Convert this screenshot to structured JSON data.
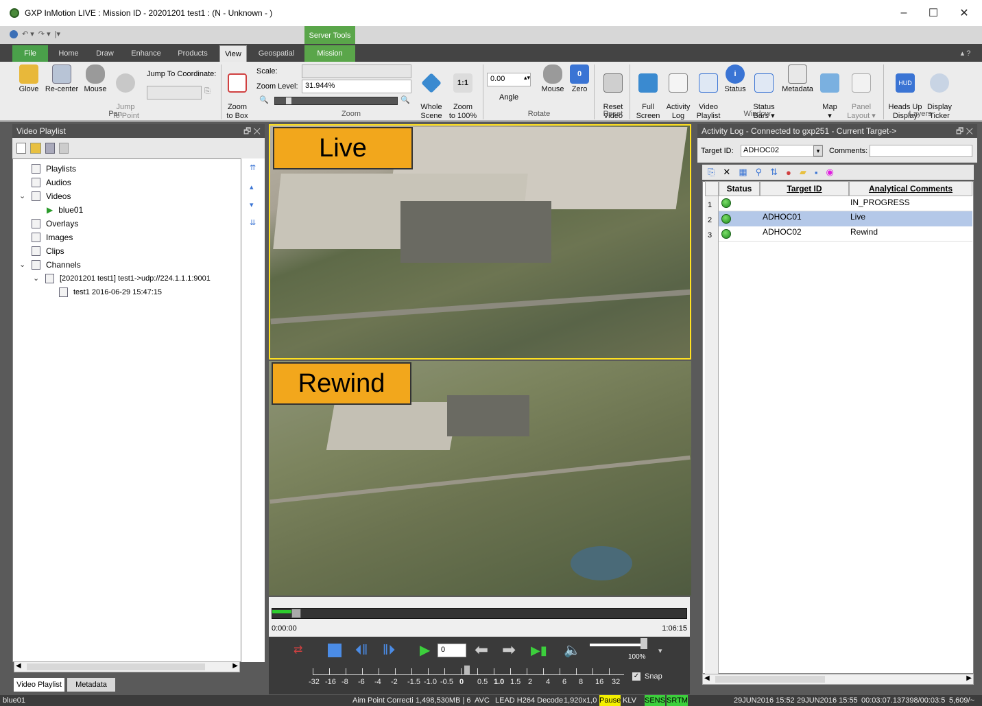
{
  "window": {
    "title": "GXP InMotion LIVE : Mission ID - 20201201 test1 : (N - Unknown - )",
    "controls": [
      "–",
      "☐",
      "✕"
    ]
  },
  "ribbon": {
    "contextual_tab": "Server Tools",
    "tabs": [
      "File",
      "Home",
      "Draw",
      "Enhance",
      "Products",
      "View",
      "Geospatial",
      "Mission"
    ],
    "active_tab": "View",
    "pan": {
      "label": "Pan",
      "glove": "Glove",
      "recenter": "Re-center",
      "mouse": "Mouse",
      "jump": "Jump\nTo Point",
      "jump_coord_label": "Jump To Coordinate:",
      "jump_coord_value": ""
    },
    "zoom": {
      "label": "Zoom",
      "zoom_to_box": "Zoom\nto Box",
      "scale_label": "Scale:",
      "scale_value": "",
      "zoom_level_label": "Zoom Level:",
      "zoom_level_value": "31.944%",
      "whole_scene": "Whole\nScene",
      "zoom_100": "Zoom\nto 100%"
    },
    "rotate": {
      "label": "Rotate",
      "angle_value": "0.00",
      "angle": "Angle",
      "mouse": "Mouse",
      "zero": "Zero"
    },
    "reset": {
      "label": "Reset",
      "reset_video": "Reset\nVideo"
    },
    "window": {
      "label": "Window",
      "full_screen": "Full\nScreen",
      "activity_log": "Activity\nLog",
      "video_playlist": "Video\nPlaylist",
      "status": "Status",
      "status_bars": "Status\nBars ▾",
      "metadata": "Metadata",
      "map": "Map\n▾",
      "panel_layout": "Panel\nLayout ▾"
    },
    "layers": {
      "label": "Layers",
      "heads_up": "Heads Up\nDisplay",
      "display_ticker": "Display\nTicker"
    }
  },
  "playlist_panel": {
    "title": "Video Playlist",
    "items": {
      "playlists": "Playlists",
      "audios": "Audios",
      "videos": "Videos",
      "blue01": "blue01",
      "overlays": "Overlays",
      "images": "Images",
      "clips": "Clips",
      "channels": "Channels",
      "channel": "[20201201 test1] test1->udp://224.1.1.1:9001",
      "recording": "test1 2016-06-29 15:47:15"
    },
    "tabs": [
      "Video Playlist",
      "Metadata"
    ]
  },
  "video": {
    "live_label": "Live",
    "rewind_label": "Rewind",
    "time_start": "0:00:00",
    "time_end": "1:06:15",
    "frame_step": "0",
    "volume": "100%",
    "snap": "Snap",
    "ruler": [
      "-32",
      "-16",
      "-8",
      "-6",
      "-4",
      "-2",
      "-1.5",
      "-1.0",
      "-0.5",
      "0",
      "0.5",
      "1.0",
      "1.5",
      "2",
      "4",
      "6",
      "8",
      "16",
      "32"
    ]
  },
  "activity_log": {
    "title": "Activity Log - Connected to gxp251 - Current Target->",
    "target_id_label": "Target ID:",
    "target_id_value": "ADHOC02",
    "comments_label": "Comments:",
    "comments_value": "",
    "columns": [
      "Status",
      "Target ID",
      "Analytical Comments"
    ],
    "rows": [
      {
        "n": "1",
        "target": "",
        "comment": "IN_PROGRESS"
      },
      {
        "n": "2",
        "target": "ADHOC01",
        "comment": "Live"
      },
      {
        "n": "3",
        "target": "ADHOC02",
        "comment": "Rewind"
      }
    ]
  },
  "statusbar": {
    "left": "blue01",
    "aim": "Aim Point Correcti",
    "size": "1,498,530MB | 6",
    "avc": "AVC",
    "decode": "LEAD H264 Decode",
    "res": "1,920x1,0",
    "pause": "Pause",
    "klv": "KLV",
    "sens": "SENS",
    "srtm": "SRTM",
    "date1": "29JUN2016 15:52",
    "date2": "29JUN2016 15:55",
    "pos": "00:03:07.137398/00:03:5",
    "frames": "5,609/~"
  }
}
